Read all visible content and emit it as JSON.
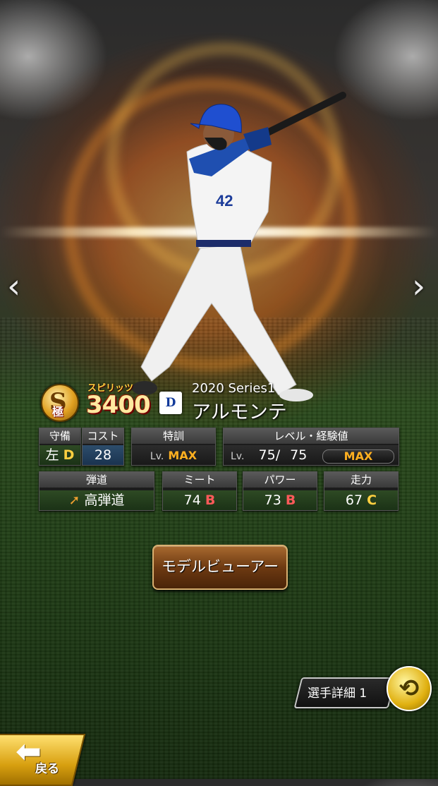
{
  "card": {
    "rank_letter": "S",
    "rank_suffix": "極",
    "spirits_label": "スピリッツ",
    "spirits_value": "3400",
    "team_logo": "D",
    "series": "2020 Series1",
    "player_name": "アルモンテ",
    "uniform_number": "42"
  },
  "stats": {
    "fielding": {
      "label": "守備",
      "hand": "左",
      "grade": "D"
    },
    "cost": {
      "label": "コスト",
      "value": "28"
    },
    "training": {
      "label": "特訓",
      "lv_prefix": "Lv.",
      "value": "MAX"
    },
    "level": {
      "label": "レベル・経験値",
      "lv_prefix": "Lv.",
      "current": "75",
      "separator": "/",
      "max": "75",
      "bar_text": "MAX"
    },
    "trajectory": {
      "label": "弾道",
      "value": "高弾道"
    },
    "meet": {
      "label": "ミート",
      "value": "74",
      "grade": "B"
    },
    "power": {
      "label": "パワー",
      "value": "73",
      "grade": "B"
    },
    "speed": {
      "label": "走力",
      "value": "67",
      "grade": "C"
    }
  },
  "buttons": {
    "model_viewer": "モデルビューアー",
    "player_detail": "選手詳細 1",
    "back": "戻る"
  },
  "nav": {
    "prev": "‹",
    "next": "›"
  },
  "colors": {
    "grade_b": "#ff5a5a",
    "grade_c": "#ffd040",
    "grade_d": "#ffd040",
    "max": "#ffb020"
  }
}
